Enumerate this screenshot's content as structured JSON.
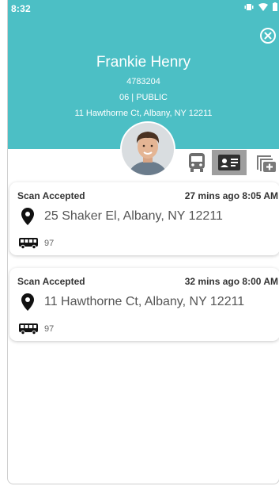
{
  "status_bar": {
    "time": "8:32",
    "icons": [
      "vibrate-icon",
      "wifi-icon",
      "battery-icon"
    ]
  },
  "profile": {
    "name": "Frankie Henry",
    "id": "4783204",
    "grade_school": "06 | PUBLIC",
    "address": "11 Hawthorne Ct, Albany, NY 12211"
  },
  "tabs": [
    {
      "icon": "bus-icon",
      "selected": false
    },
    {
      "icon": "id-card-icon",
      "selected": true
    },
    {
      "icon": "add-copy-icon",
      "selected": false
    }
  ],
  "scans": [
    {
      "status": "Scan Accepted",
      "time": "27 mins ago  8:05 AM",
      "address": "25 Shaker El, Albany, NY 12211",
      "route": "97"
    },
    {
      "status": "Scan Accepted",
      "time": "32 mins ago  8:00 AM",
      "address": "11 Hawthorne Ct, Albany, NY 12211",
      "route": "97"
    }
  ],
  "colors": {
    "header": "#4cbfc5",
    "selected_tab": "#9e9e9e",
    "text": "#333333"
  }
}
